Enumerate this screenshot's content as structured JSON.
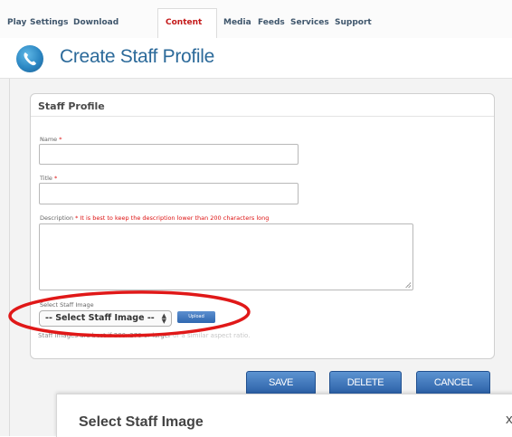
{
  "nav": {
    "tabs": [
      {
        "label": "Play"
      },
      {
        "label": "Settings"
      },
      {
        "label": "Download"
      },
      {
        "label": "Content"
      },
      {
        "label": "Media"
      },
      {
        "label": "Feeds"
      },
      {
        "label": "Services"
      },
      {
        "label": "Support"
      }
    ],
    "active_tab": "Content"
  },
  "header": {
    "title": "Create Staff Profile",
    "logo_icon": "phone-logo-icon"
  },
  "form": {
    "panel_title": "Staff Profile",
    "name": {
      "label": "Name",
      "required_mark": "*",
      "value": ""
    },
    "title": {
      "label": "Title",
      "required_mark": "*",
      "value": ""
    },
    "description": {
      "label": "Description",
      "required_mark": "*",
      "note": "It is best to keep the description lower than 200 characters long",
      "value": ""
    },
    "image": {
      "label": "Select Staff Image",
      "selected": "-- Select Staff Image --",
      "upload_label": "Upload",
      "hint_visible": "Staff images are best if 200x270 or larger",
      "hint_obscured": "or a similar aspect ratio."
    }
  },
  "actions": {
    "save": "SAVE",
    "delete": "DELETE",
    "cancel": "CANCEL"
  },
  "dialog": {
    "title": "Select Staff Image",
    "close": "x"
  },
  "colors": {
    "accent_blue": "#2c6a9a",
    "button_blue": "#2a5fa6",
    "active_tab_red": "#c41a1a",
    "annotation_red": "#e01818"
  }
}
